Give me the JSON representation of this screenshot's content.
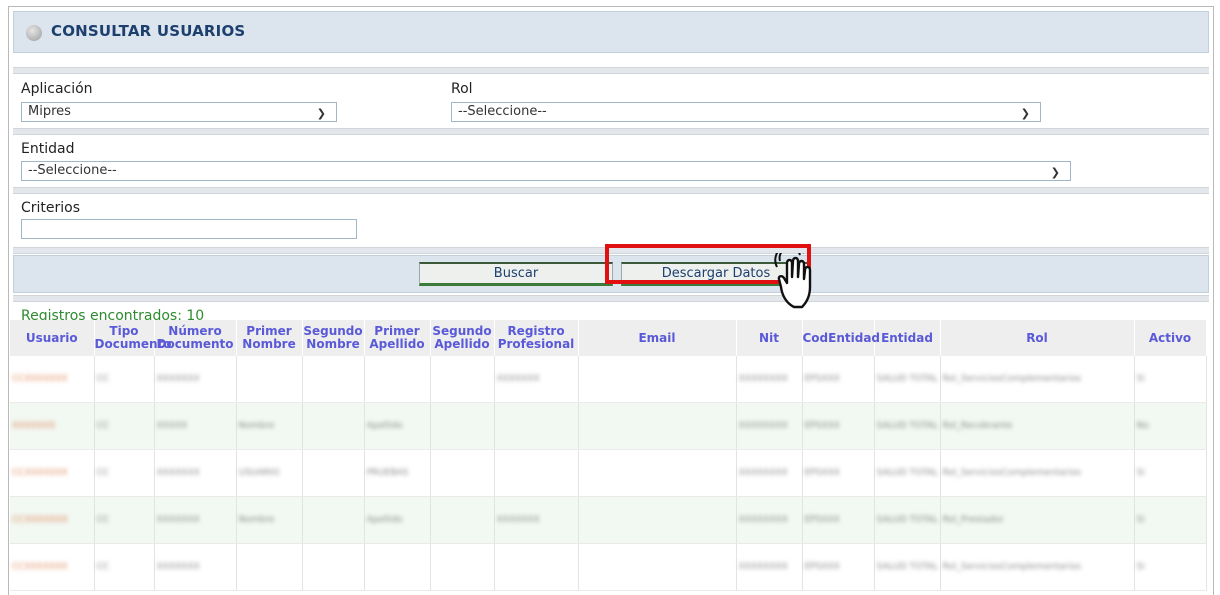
{
  "header": {
    "title": "CONSULTAR USUARIOS"
  },
  "form": {
    "aplicacion": {
      "label": "Aplicación",
      "value": "Mipres"
    },
    "rol": {
      "label": "Rol",
      "value": "--Seleccione--"
    },
    "entidad": {
      "label": "Entidad",
      "value": "--Seleccione--"
    },
    "criterios": {
      "label": "Criterios",
      "value": ""
    }
  },
  "buttons": {
    "buscar": "Buscar",
    "descargar": "Descargar Datos"
  },
  "results": {
    "count_text": "Registros encontrados: 10"
  },
  "table": {
    "headers": [
      "Usuario",
      "Tipo Documento",
      "Número Documento",
      "Primer Nombre",
      "Segundo Nombre",
      "Primer Apellido",
      "Segundo Apellido",
      "Registro Profesional",
      "Email",
      "Nit",
      "CodEntidad",
      "Entidad",
      "Rol",
      "Activo"
    ],
    "rows": [
      [
        "CCXXXXXXX",
        "CC",
        "XXXXXXX",
        "",
        "",
        "",
        "",
        "XXXXXXX",
        "",
        "XXXXXXXX",
        "EPSXXX",
        "SALUD TOTAL S.A.",
        "Rol_ServiciosComplementarios",
        "Si"
      ],
      [
        "XXXXXXX",
        "CC",
        "XXXXX",
        "Nombre",
        "",
        "Apellido",
        "",
        "",
        "",
        "XXXXXXXX",
        "EPSXXX",
        "SALUD TOTAL S.A.",
        "Rol_Recobrante",
        "No"
      ],
      [
        "CCXXXXXXX",
        "CC",
        "XXXXXXX",
        "USUARIO",
        "",
        "PRUEBAS",
        "",
        "",
        "",
        "XXXXXXXX",
        "EPSXXX",
        "SALUD TOTAL S.A.",
        "Rol_ServiciosComplementarios",
        "Si"
      ],
      [
        "CCXXXXXXX",
        "CC",
        "XXXXXXX",
        "Nombre",
        "",
        "Apellido",
        "",
        "XXXXXXX",
        "",
        "XXXXXXXX",
        "EPSXXX",
        "SALUD TOTAL S.A.",
        "Rol_Prestador",
        "Si"
      ],
      [
        "CCXXXXXXX",
        "CC",
        "XXXXXXX",
        "",
        "",
        "",
        "",
        "",
        "",
        "XXXXXXXX",
        "EPSXXX",
        "SALUD TOTAL S.A.",
        "Rol_ServiciosComplementarios",
        "Si"
      ]
    ]
  }
}
